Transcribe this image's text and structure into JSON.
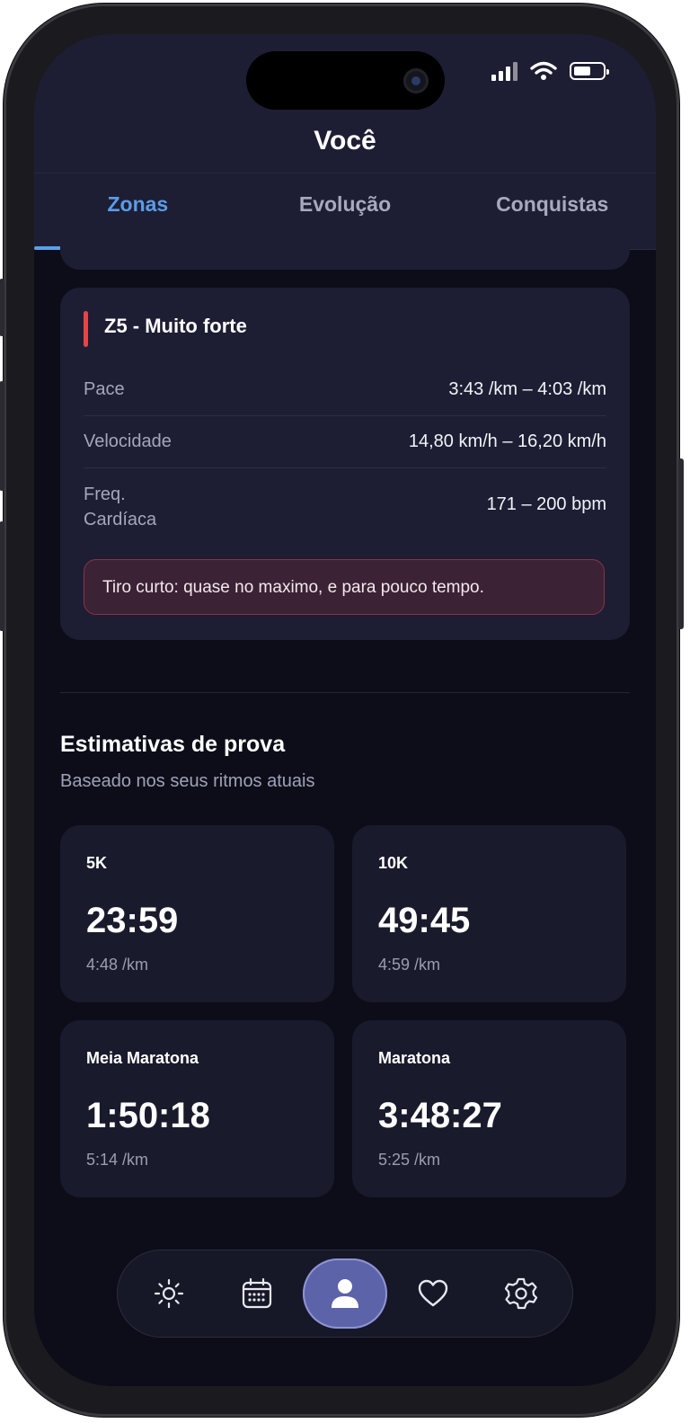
{
  "status_bar": {
    "icons": [
      "signal-icon",
      "wifi-icon",
      "battery-icon"
    ]
  },
  "header": {
    "title": "Você"
  },
  "tabs": [
    {
      "label": "Zonas",
      "active": true
    },
    {
      "label": "Evolução",
      "active": false
    },
    {
      "label": "Conquistas",
      "active": false
    }
  ],
  "zone_card": {
    "title": "Z5 - Muito forte",
    "accent_color": "#e64545",
    "rows": [
      {
        "label": "Pace",
        "value": "3:43 /km – 4:03 /km"
      },
      {
        "label": "Velocidade",
        "value": "14,80 km/h – 16,20 km/h"
      },
      {
        "label_line1": "Freq.",
        "label_line2": "Cardíaca",
        "value": "171 – 200 bpm"
      }
    ],
    "note": "Tiro curto: quase no maximo, e para pouco tempo."
  },
  "estimates": {
    "title": "Estimativas de prova",
    "subtitle": "Baseado nos seus ritmos atuais",
    "items": [
      {
        "name": "5K",
        "time": "23:59",
        "pace": "4:48 /km"
      },
      {
        "name": "10K",
        "time": "49:45",
        "pace": "4:59 /km"
      },
      {
        "name": "Meia Maratona",
        "time": "1:50:18",
        "pace": "5:14 /km"
      },
      {
        "name": "Maratona",
        "time": "3:48:27",
        "pace": "5:25 /km"
      }
    ]
  },
  "bottom_nav": {
    "items": [
      "sun-icon",
      "calendar-icon",
      "user-icon",
      "heart-icon",
      "gear-icon"
    ],
    "active": "user-icon"
  },
  "colors": {
    "accent": "#5aa0e8",
    "background": "#0d0d1a",
    "card": "#1d1e33",
    "danger": "#e64545"
  }
}
